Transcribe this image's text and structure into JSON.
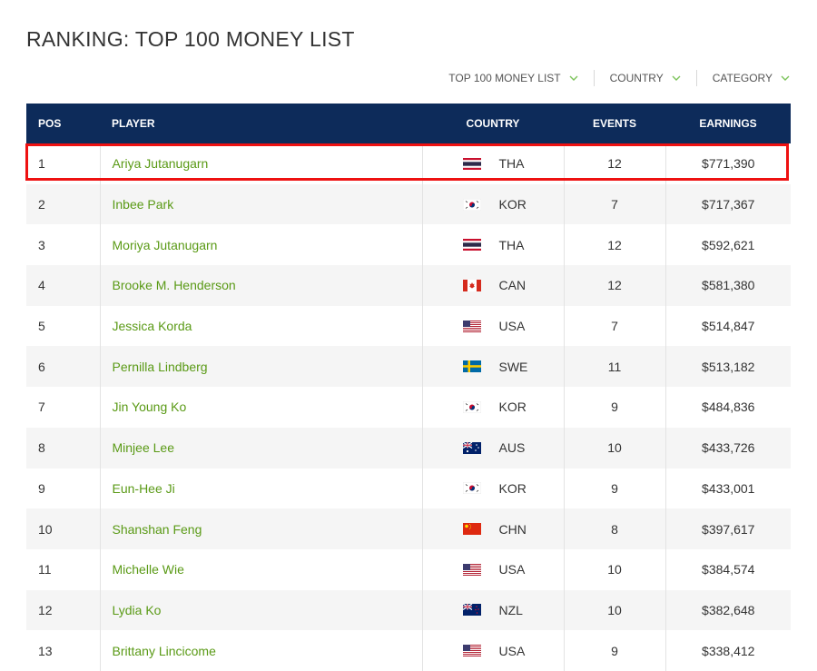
{
  "page": {
    "title": "RANKING: TOP 100 MONEY LIST"
  },
  "filters": [
    {
      "label": "TOP 100 MONEY LIST",
      "icon": "chevron-down-icon"
    },
    {
      "label": "COUNTRY",
      "icon": "chevron-down-icon"
    },
    {
      "label": "CATEGORY",
      "icon": "chevron-down-icon"
    }
  ],
  "table": {
    "headers": {
      "pos": "POS",
      "player": "PLAYER",
      "country": "COUNTRY",
      "events": "EVENTS",
      "earnings": "EARNINGS"
    },
    "rows": [
      {
        "pos": "1",
        "player": "Ariya Jutanugarn",
        "flag": "flag-thailand-icon",
        "country": "THA",
        "events": "12",
        "earnings": "$771,390",
        "highlighted": true
      },
      {
        "pos": "2",
        "player": "Inbee Park",
        "flag": "flag-korea-icon",
        "country": "KOR",
        "events": "7",
        "earnings": "$717,367"
      },
      {
        "pos": "3",
        "player": "Moriya Jutanugarn",
        "flag": "flag-thailand-icon",
        "country": "THA",
        "events": "12",
        "earnings": "$592,621"
      },
      {
        "pos": "4",
        "player": "Brooke M. Henderson",
        "flag": "flag-canada-icon",
        "country": "CAN",
        "events": "12",
        "earnings": "$581,380"
      },
      {
        "pos": "5",
        "player": "Jessica Korda",
        "flag": "flag-usa-icon",
        "country": "USA",
        "events": "7",
        "earnings": "$514,847"
      },
      {
        "pos": "6",
        "player": "Pernilla Lindberg",
        "flag": "flag-sweden-icon",
        "country": "SWE",
        "events": "11",
        "earnings": "$513,182"
      },
      {
        "pos": "7",
        "player": "Jin Young Ko",
        "flag": "flag-korea-icon",
        "country": "KOR",
        "events": "9",
        "earnings": "$484,836"
      },
      {
        "pos": "8",
        "player": "Minjee Lee",
        "flag": "flag-australia-icon",
        "country": "AUS",
        "events": "10",
        "earnings": "$433,726"
      },
      {
        "pos": "9",
        "player": "Eun-Hee Ji",
        "flag": "flag-korea-icon",
        "country": "KOR",
        "events": "9",
        "earnings": "$433,001"
      },
      {
        "pos": "10",
        "player": "Shanshan Feng",
        "flag": "flag-china-icon",
        "country": "CHN",
        "events": "8",
        "earnings": "$397,617"
      },
      {
        "pos": "11",
        "player": "Michelle Wie",
        "flag": "flag-usa-icon",
        "country": "USA",
        "events": "10",
        "earnings": "$384,574"
      },
      {
        "pos": "12",
        "player": "Lydia Ko",
        "flag": "flag-new-zealand-icon",
        "country": "NZL",
        "events": "10",
        "earnings": "$382,648"
      },
      {
        "pos": "13",
        "player": "Brittany Lincicome",
        "flag": "flag-usa-icon",
        "country": "USA",
        "events": "9",
        "earnings": "$338,412"
      }
    ]
  },
  "colors": {
    "header_bg": "#0d2b5a",
    "player_link": "#5a9a16",
    "highlight_border": "#ee1111",
    "chevron": "#7cc35a"
  }
}
